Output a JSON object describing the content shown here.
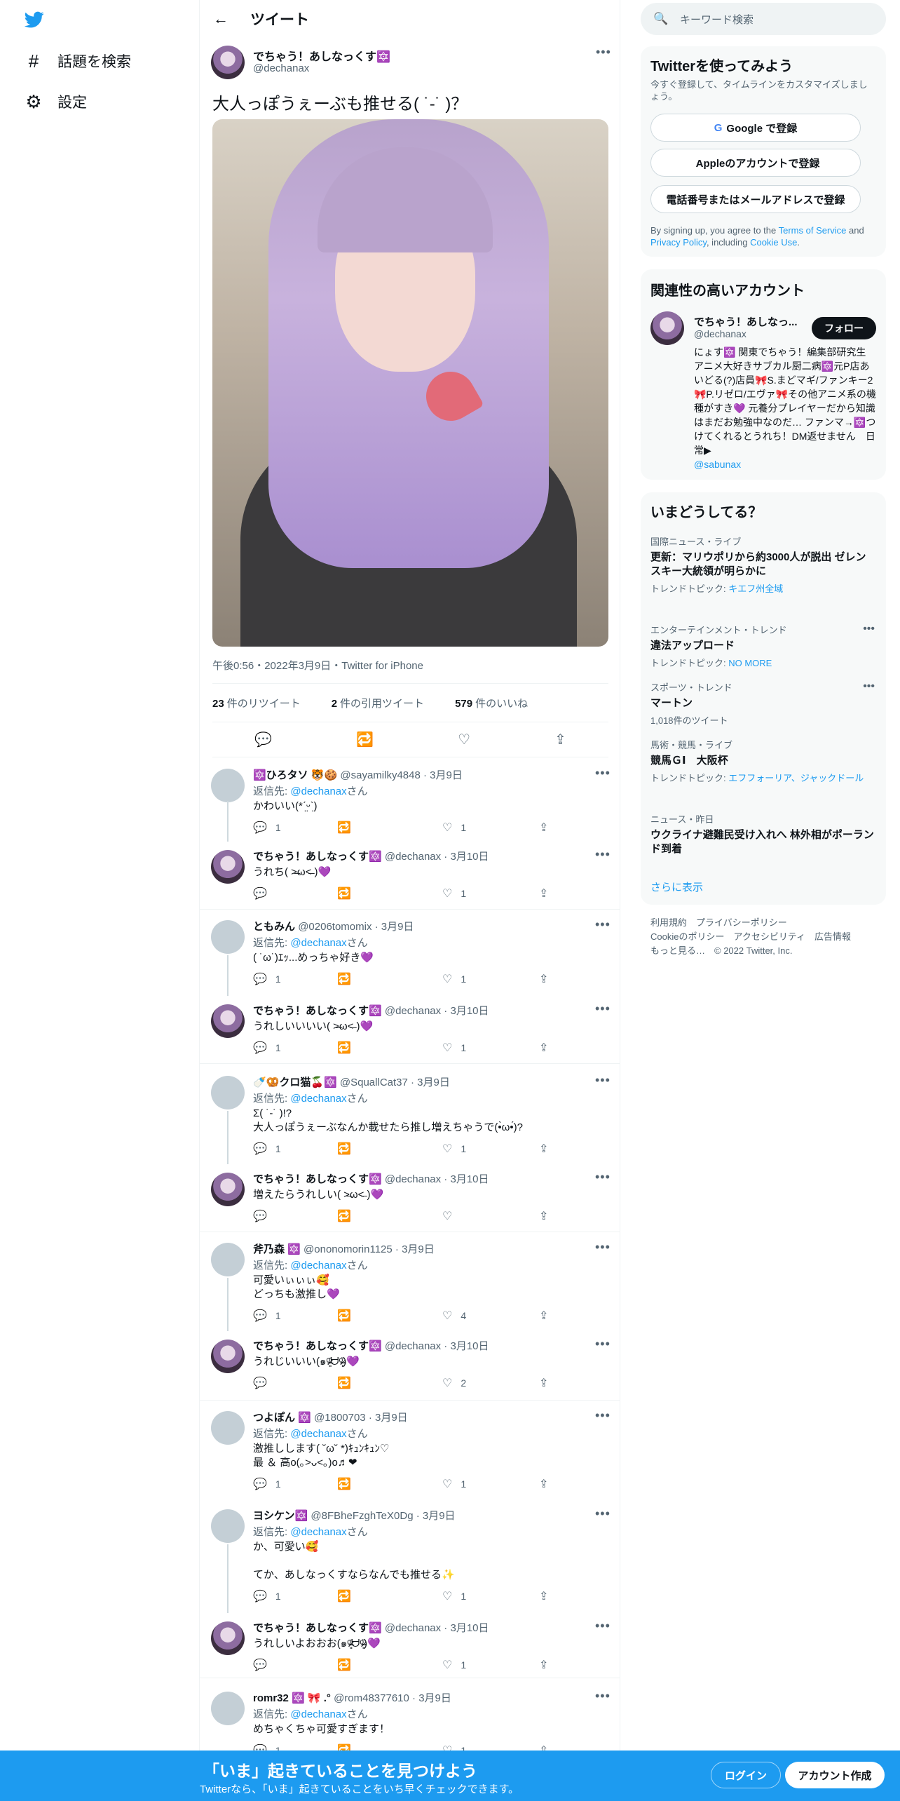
{
  "nav": {
    "explore_label": "話題を検索",
    "settings_label": "設定"
  },
  "header": {
    "title": "ツイート"
  },
  "main_tweet": {
    "name": "でちゃう！あしなっくす🔯",
    "handle": "@dechanax",
    "text": "大人っぽうぇーぶも推せる( ˙-˙ )？",
    "time": "午後0:56・2022年3月9日・Twitter for iPhone",
    "stats": {
      "retweets_count": "23",
      "retweets_label": "件のリツイート",
      "quotes_count": "2",
      "quotes_label": "件の引用ツイート",
      "likes_count": "579",
      "likes_label": "件のいいね"
    }
  },
  "replies": [
    {
      "name": "🔯ひろタソ 🐯🍪",
      "handle": "@sayamilky4848 · 3月9日",
      "to_label": "返信先:",
      "to_user": "@dechanax",
      "to_suffix": "さん",
      "text": "かわいい(*ˊ̤ᵕˋ̤)",
      "reply": "1",
      "rt": "",
      "like": "1"
    },
    {
      "name": "でちゃう！あしなっくす🔯",
      "handle": "@dechanax · 3月10日",
      "text": "うれち( ˃̶ω˂̶ )💜",
      "reply": "",
      "rt": "",
      "like": "1"
    },
    {
      "name": "ともみん",
      "handle": "@0206tomomix · 3月9日",
      "to_label": "返信先:",
      "to_user": "@dechanax",
      "to_suffix": "さん",
      "text": "( ˙ω˙)ｴｯ...めっちゃ好き💜",
      "reply": "1",
      "rt": "",
      "like": "1"
    },
    {
      "name": "でちゃう！あしなっくす🔯",
      "handle": "@dechanax · 3月10日",
      "text": "うれしいいいい( ˃̶ω˂̶ )💜",
      "reply": "1",
      "rt": "",
      "like": "1"
    },
    {
      "name": "🍼🥨クロ猫🍒🔯",
      "handle": "@SquallCat37 · 3月9日",
      "to_label": "返信先:",
      "to_user": "@dechanax",
      "to_suffix": "さん",
      "text": "Σ( ˙-˙ )!?\n大人っぽうぇーぶなんか載せたら推し増えちゃうで(•̀ω•́)?",
      "reply": "1",
      "rt": "",
      "like": "1"
    },
    {
      "name": "でちゃう！あしなっくす🔯",
      "handle": "@dechanax · 3月10日",
      "text": "増えたらうれしい( ˃̶ω˂̶ )💜",
      "reply": "",
      "rt": "",
      "like": ""
    },
    {
      "name": "斧乃森 🔯",
      "handle": "@ononomorin1125 · 3月9日",
      "to_label": "返信先:",
      "to_user": "@dechanax",
      "to_suffix": "さん",
      "text": "可愛いぃぃぃ🥰\nどっちも激推し💜",
      "reply": "1",
      "rt": "",
      "like": "4"
    },
    {
      "name": "でちゃう！あしなっくす🔯",
      "handle": "@dechanax · 3月10日",
      "text": "うれじいいい(๑ᵒ̴̶̷͈᷄ᗨᵒ̴̶̷͈᷅)💜",
      "reply": "",
      "rt": "",
      "like": "2"
    },
    {
      "name": "つよぽん 🔯",
      "handle": "@1800703 · 3月9日",
      "to_label": "返信先:",
      "to_user": "@dechanax",
      "to_suffix": "さん",
      "text": "激推しします( ˘ω˘ *)ｷｭﾝｷｭﾝ♡\n最 ＆ 高o(｡>ᴗ<｡)o♬❤",
      "reply": "1",
      "rt": "",
      "like": "1"
    },
    {
      "name": "ヨシケン🔯",
      "handle": "@8FBheFzghTeX0Dg · 3月9日",
      "to_label": "返信先:",
      "to_user": "@dechanax",
      "to_suffix": "さん",
      "text": "か、可愛い🥰\n\nてか、あしなっくすならなんでも推せる✨",
      "reply": "1",
      "rt": "",
      "like": "1"
    },
    {
      "name": "でちゃう！あしなっくす🔯",
      "handle": "@dechanax · 3月10日",
      "text": "うれしいよおおお(๑ᵒ̴̶̷͈᷄ᗨᵒ̴̶̷͈᷅)💜",
      "reply": "",
      "rt": "",
      "like": "1"
    },
    {
      "name": "romr32 🔯 🎀 .°",
      "handle": "@rom48377610 · 3月9日",
      "to_label": "返信先:",
      "to_user": "@dechanax",
      "to_suffix": "さん",
      "text": "めちゃくちゃ可愛すぎます！",
      "reply": "1",
      "rt": "",
      "like": "1"
    }
  ],
  "search": {
    "placeholder": "キーワード検索"
  },
  "signup_card": {
    "title": "Twitterを使ってみよう",
    "subtitle": "今すぐ登録して、タイムラインをカスタマイズしましょう。",
    "google_label": "Google で登録",
    "apple_label": "Appleのアカウントで登録",
    "phone_label": "電話番号またはメールアドレスで登録",
    "terms_pre": "By signing up, you agree to the ",
    "terms_link": "Terms of Service",
    "terms_mid": " and ",
    "privacy_link": "Privacy Policy",
    "terms_mid2": ", including ",
    "cookie_link": "Cookie Use",
    "terms_end": "."
  },
  "related_card": {
    "title": "関連性の高いアカウント",
    "name": "でちゃう！あしなっ...",
    "handle": "@dechanax",
    "follow_label": "フォロー",
    "bio": "にょす🔯 関東でちゃう！編集部研究生　アニメ大好きサブカル厨二病🔯元P店あいどる(?)店員🎀S.まどマギ/ファンキー2🎀P.リゼロ/エヴァ🎀その他アニメ系の機種がすき💜 元養分プレイヤーだから知識はまだお勉強中なのだ… ファンマ→🔯つけてくれるとうれち！DM返せません　日常▶",
    "bio_link": "@sabunax"
  },
  "trends": {
    "title": "いまどうしてる？",
    "items": [
      {
        "cat": "国際ニュース・ライブ",
        "title": "更新：マリウポリから約3000人が脱出 ゼレンスキー大統領が明らかに",
        "sub_label": "トレンドトピック: ",
        "sub_link": "キエフ州全域"
      },
      {
        "cat": "エンターテインメント・トレンド",
        "title": "違法アップロード",
        "sub_label": "トレンドトピック: ",
        "sub_link": "NO MORE"
      },
      {
        "cat": "スポーツ・トレンド",
        "title": "マートン",
        "sub_label": "1,018件のツイート",
        "sub_link": ""
      },
      {
        "cat": "馬術・競馬・ライブ",
        "title": "競馬ＧⅠ　大阪杯",
        "sub_label": "トレンドトピック: ",
        "sub_link": "エフフォーリア、ジャックドール"
      },
      {
        "cat": "ニュース・昨日",
        "title": "ウクライナ避難民受け入れへ 林外相がポーランド到着",
        "sub_label": "",
        "sub_link": ""
      }
    ],
    "more_label": "さらに表示"
  },
  "footer": {
    "line1": "利用規約　プライバシーポリシー",
    "line2": "Cookieのポリシー　アクセシビリティ　広告情報",
    "line3": "もっと見る…　© 2022 Twitter, Inc."
  },
  "banner": {
    "title": "「いま」起きていることを見つけよう",
    "subtitle": "Twitterなら、「いま」起きていることをいち早くチェックできます。",
    "login_label": "ログイン",
    "signup_label": "アカウント作成"
  },
  "colors": {
    "accent": "#1d9bf0",
    "text": "#0f1419",
    "muted": "#536471"
  }
}
